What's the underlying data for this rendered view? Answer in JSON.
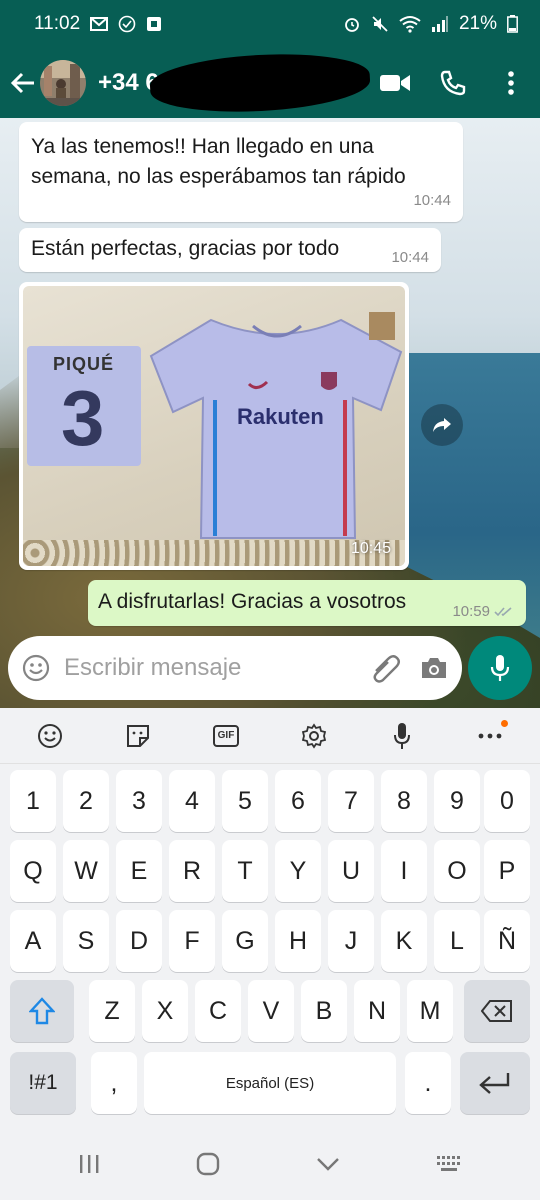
{
  "status_bar": {
    "time": "11:02",
    "battery": "21%",
    "left_icons": [
      "gmail-icon",
      "check-circle-icon",
      "app-icon"
    ],
    "right_icons": [
      "alarm-icon",
      "mute-icon",
      "wifi-icon",
      "signal-icon",
      "battery-icon"
    ]
  },
  "header": {
    "contact": "+34 6",
    "actions": [
      "video-call-icon",
      "phone-icon",
      "more-vert-icon"
    ]
  },
  "messages": [
    {
      "text": "Ya las tenemos!! Han llegado en una semana, no las esperábamos tan rápido",
      "time": "10:44",
      "direction": "in"
    },
    {
      "text": "Están perfectas, gracias por todo",
      "time": "10:44",
      "direction": "in"
    },
    {
      "type": "image",
      "time": "10:45",
      "direction": "in",
      "shirt_name": "PIQUÉ",
      "shirt_number": "3",
      "brand": "Rakuten"
    },
    {
      "text": "A disfrutarlas! Gracias a vosotros",
      "time": "10:59",
      "direction": "out",
      "status": "read"
    }
  ],
  "composer": {
    "placeholder": "Escribir mensaje"
  },
  "keyboard": {
    "toolbar": [
      "emoji-icon",
      "sticker-icon",
      "gif-icon",
      "settings-icon",
      "voice-icon",
      "more-icon"
    ],
    "gif_label": "GIF",
    "row_numbers": [
      "1",
      "2",
      "3",
      "4",
      "5",
      "6",
      "7",
      "8",
      "9",
      "0"
    ],
    "row1": [
      "Q",
      "W",
      "E",
      "R",
      "T",
      "Y",
      "U",
      "I",
      "O",
      "P"
    ],
    "row2": [
      "A",
      "S",
      "D",
      "F",
      "G",
      "H",
      "J",
      "K",
      "L",
      "Ñ"
    ],
    "row3": [
      "Z",
      "X",
      "C",
      "V",
      "B",
      "N",
      "M"
    ],
    "symbols": "!#1",
    "comma": ",",
    "space": "Español (ES)",
    "period": "."
  },
  "colors": {
    "header": "#075e54",
    "accent": "#00897b",
    "outgoing": "#dcf8c6",
    "read_ticks": "#9aa9b0"
  }
}
